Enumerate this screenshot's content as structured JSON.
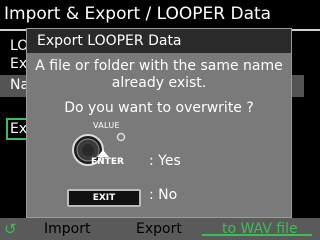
{
  "header": {
    "title": "Import & Export / LOOPER Data"
  },
  "background_rows": [
    {
      "label": "LO"
    },
    {
      "label": "Ex"
    },
    {
      "label": "Na"
    }
  ],
  "background_button": {
    "label": "Ex"
  },
  "dialog": {
    "title": "Export LOOPER Data",
    "message_line1": "A file or folder with the same name",
    "message_line2": "already exist.",
    "question": "Do you want to overwrite ?",
    "knob_label": "VALUE",
    "enter_label": "ENTER",
    "yes_label": ": Yes",
    "exit_label": "EXIT",
    "no_label": ": No"
  },
  "footer": {
    "refresh_icon": "↺",
    "tabs": [
      {
        "label": "Import",
        "active": false
      },
      {
        "label": "Export",
        "active": false
      },
      {
        "label": "to WAV file",
        "active": true
      }
    ]
  },
  "colors": {
    "accent": "#3dbd55",
    "dialog_bg": "#7a7a7a",
    "title_bar": "#2a2a2a"
  }
}
